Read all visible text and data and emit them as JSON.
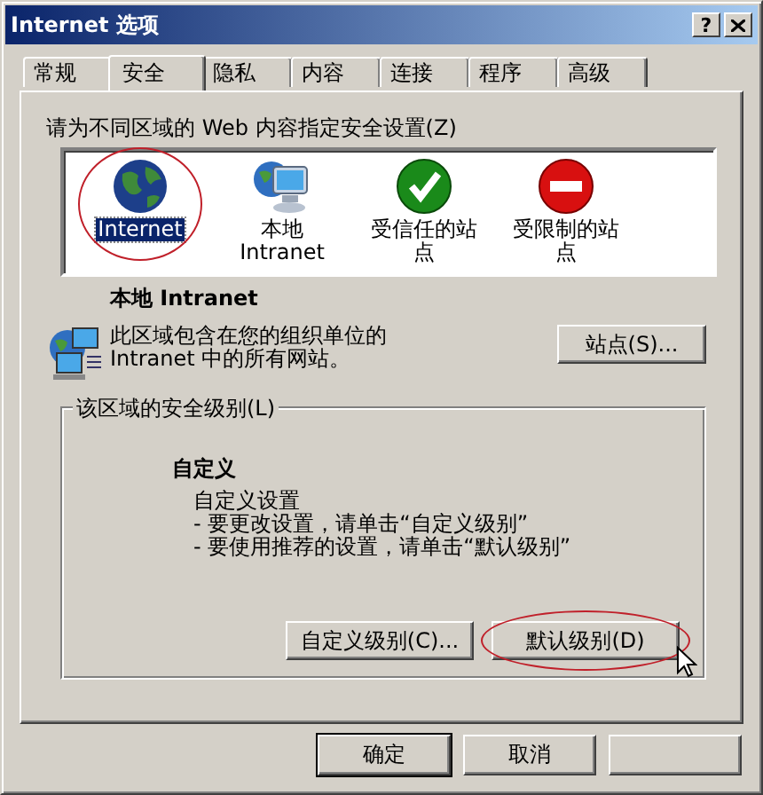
{
  "window": {
    "title": "Internet 选项",
    "help_button": "?"
  },
  "tabs": [
    {
      "label": "常规",
      "selected": false
    },
    {
      "label": "安全",
      "selected": true
    },
    {
      "label": "隐私",
      "selected": false
    },
    {
      "label": "内容",
      "selected": false
    },
    {
      "label": "连接",
      "selected": false
    },
    {
      "label": "程序",
      "selected": false
    },
    {
      "label": "高级",
      "selected": false
    }
  ],
  "zones_prompt": "请为不同区域的 Web 内容指定安全设置(Z)",
  "zones": [
    {
      "kind": "globe",
      "label": "Internet",
      "selected": true,
      "circled": true
    },
    {
      "kind": "intranet",
      "label": "本地 Intranet",
      "selected": false,
      "circled": false
    },
    {
      "kind": "trusted",
      "label": "受信任的站点",
      "selected": false,
      "circled": false
    },
    {
      "kind": "restricted",
      "label": "受限制的站点",
      "selected": false,
      "circled": false
    }
  ],
  "zone_detail": {
    "title": "本地 Intranet",
    "description": "此区域包含在您的组织单位的 Intranet 中的所有网站。",
    "sites_button": "站点(S)..."
  },
  "security_level": {
    "legend": "该区域的安全级别(L)",
    "level_name": "自定义",
    "lines": [
      "自定义设置",
      "- 要更改设置，请单击“自定义级别”",
      "- 要使用推荐的设置，请单击“默认级别”"
    ],
    "buttons": [
      {
        "label": "自定义级别(C)...",
        "circled": false,
        "pointer": false
      },
      {
        "label": "默认级别(D)",
        "circled": true,
        "pointer": true
      }
    ]
  },
  "dialog_buttons": [
    {
      "label": "确定",
      "default": true
    },
    {
      "label": "取消",
      "default": false
    }
  ]
}
